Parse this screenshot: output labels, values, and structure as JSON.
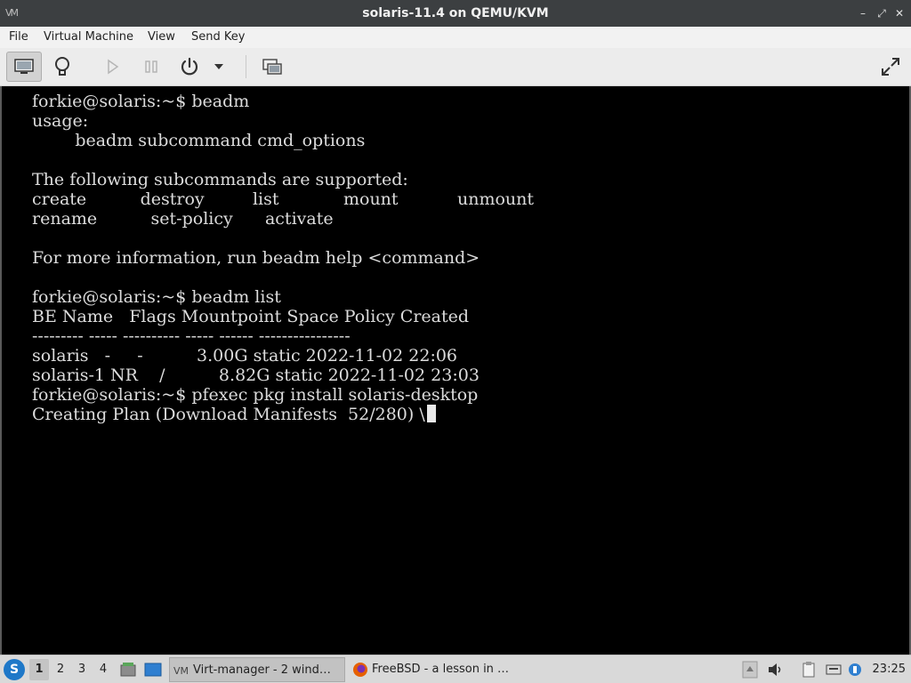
{
  "window": {
    "title": "solaris-11.4 on QEMU/KVM",
    "app_icon_text": "VM",
    "controls": {
      "minimize": "–",
      "restore": "⤢",
      "close": "✕"
    }
  },
  "menubar": {
    "items": [
      "File",
      "Virtual Machine",
      "View",
      "Send Key"
    ]
  },
  "toolbar": {
    "buttons": [
      "console-view",
      "details-view",
      "run",
      "pause",
      "power",
      "power-menu",
      "snapshots",
      "fullscreen"
    ]
  },
  "console": {
    "lines": [
      "forkie@solaris:~$ beadm",
      "usage:",
      "        beadm subcommand cmd_options",
      "",
      "The following subcommands are supported:",
      "create          destroy         list            mount           unmount",
      "rename          set-policy      activate",
      "",
      "For more information, run beadm help <command>",
      "",
      "forkie@solaris:~$ beadm list",
      "BE Name   Flags Mountpoint Space Policy Created",
      "--------- ----- ---------- ----- ------ ----------------",
      "solaris   -     -          3.00G static 2022-11-02 22:06",
      "solaris-1 NR    /          8.82G static 2022-11-02 23:03",
      "forkie@solaris:~$ pfexec pkg install solaris-desktop",
      "Creating Plan (Download Manifests  52/280) \\"
    ]
  },
  "taskbar": {
    "start_label": "S",
    "workspaces": [
      "1",
      "2",
      "3",
      "4"
    ],
    "active_workspace": "1",
    "tasks": [
      {
        "label": "Virt-manager - 2 wind…",
        "active": true,
        "icon": "virt-manager-icon"
      },
      {
        "label": "FreeBSD - a lesson in …",
        "active": false,
        "icon": "firefox-icon"
      }
    ],
    "clock": "23:25"
  },
  "colors": {
    "titlebar": "#3c3f41",
    "console_bg": "#000000",
    "console_fg": "#dcdcdc",
    "taskbar": "#d9d9d9"
  }
}
